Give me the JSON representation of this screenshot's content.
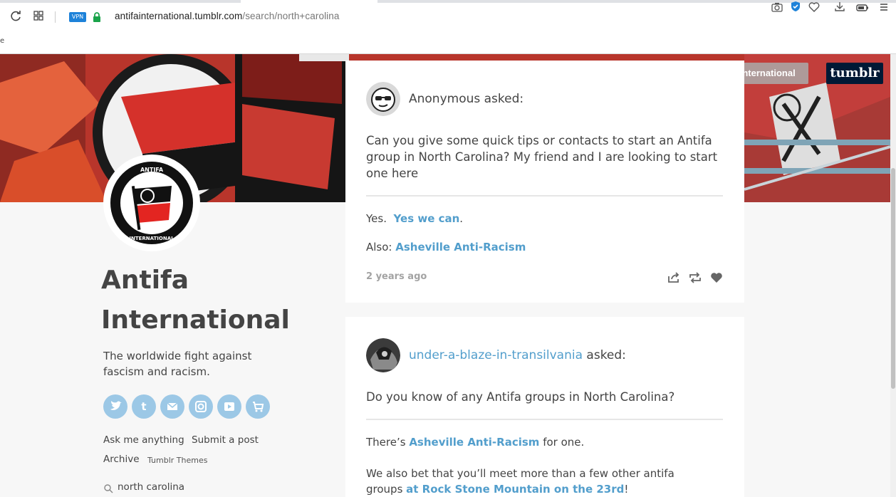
{
  "browser": {
    "vpn_label": "VPN",
    "url_host": "antifainternational.tumblr.com",
    "url_path": "/search/north+carolina",
    "side_mark": "e"
  },
  "header": {
    "follow_label": "Follow antifainternational",
    "tumblr_logo": "tumblr"
  },
  "sidebar": {
    "avatar_ring_top": "ANTIFA",
    "avatar_ring_bottom": "INTERNATIONAL",
    "title_line1": "Antifa",
    "title_line2": "International",
    "description": "The worldwide fight against fascism and racism.",
    "social": [
      {
        "icon": "twitter-icon",
        "glyph": "t"
      },
      {
        "icon": "tumblr-icon",
        "glyph": "t"
      },
      {
        "icon": "mail-icon",
        "glyph": "✉"
      },
      {
        "icon": "instagram-icon",
        "glyph": "◎"
      },
      {
        "icon": "youtube-icon",
        "glyph": "▶"
      },
      {
        "icon": "cart-icon",
        "glyph": "🛒"
      }
    ],
    "links": {
      "ask": "Ask me anything",
      "submit": "Submit a post",
      "archive": "Archive",
      "themes": "Tumblr Themes"
    },
    "search_value": "north carolina"
  },
  "posts": [
    {
      "asker": "Anonymous",
      "asked_suffix": "asked:",
      "question": "Can you give some quick tips or contacts to start an Antifa group in North Carolina? My friend and I are looking to start one here",
      "answer_line1_prefix": "Yes.",
      "answer_line1_link": "Yes we can",
      "answer_line1_suffix": ".",
      "answer_line2_prefix": "Also:",
      "answer_line2_link": "Asheville Anti-Racism",
      "time": "2 years ago"
    },
    {
      "asker": "under-a-blaze-in-transilvania",
      "asked_suffix": "asked:",
      "question": "Do you know of any Antifa groups in North Carolina?",
      "answer_line1_prefix": "There’s",
      "answer_line1_link": "Asheville Anti-Racism",
      "answer_line1_suffix": "for one.",
      "answer_line2_text": "We also bet that you’ll meet more than a few other antifa groups",
      "answer_line2_link": "at Rock Stone Mountain on the 23rd",
      "answer_line2_suffix": "!"
    }
  ],
  "colors": {
    "link": "#529ecc",
    "text": "#444444",
    "tumblr_navy": "#001935"
  }
}
